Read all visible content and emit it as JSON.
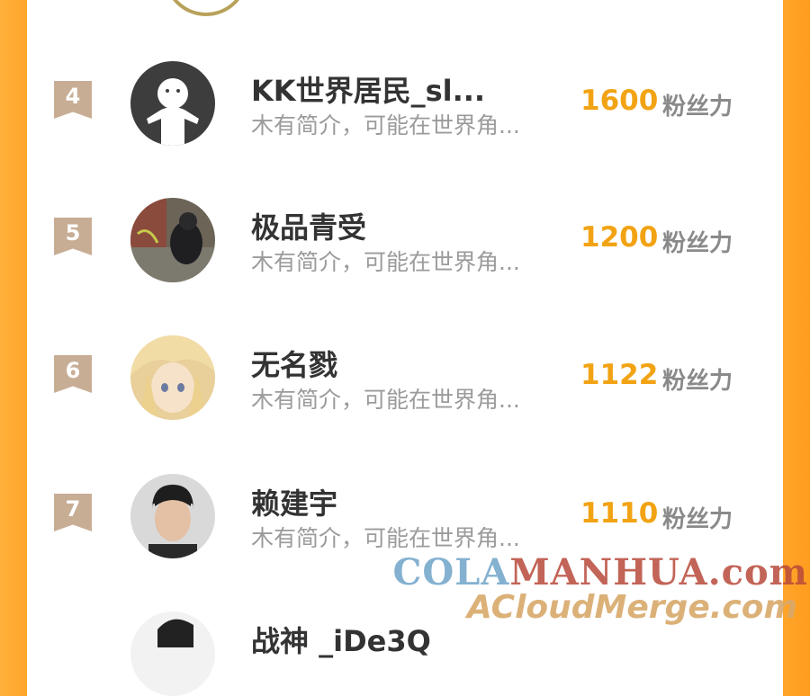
{
  "rankings": [
    {
      "rank": "4",
      "name": "KK世界居民_sl...",
      "bio": "木有简介，可能在世界角...",
      "score": "1600",
      "unit": "粉丝力"
    },
    {
      "rank": "5",
      "name": "极品青受",
      "bio": "木有简介，可能在世界角...",
      "score": "1200",
      "unit": "粉丝力"
    },
    {
      "rank": "6",
      "name": "无名戮",
      "bio": "木有简介，可能在世界角...",
      "score": "1122",
      "unit": "粉丝力"
    },
    {
      "rank": "7",
      "name": "赖建宇",
      "bio": "木有简介，可能在世界角...",
      "score": "1110",
      "unit": "粉丝力"
    }
  ],
  "partial_next": {
    "name": "战神 _iDe3Q"
  },
  "watermark": {
    "line1_a": "COLA",
    "line1_b": "MANHUA.com",
    "line2": "ACloudMerge.com"
  },
  "colors": {
    "accent": "#f2a313",
    "border": "#ffa52a",
    "badge": "#c8ad95"
  }
}
